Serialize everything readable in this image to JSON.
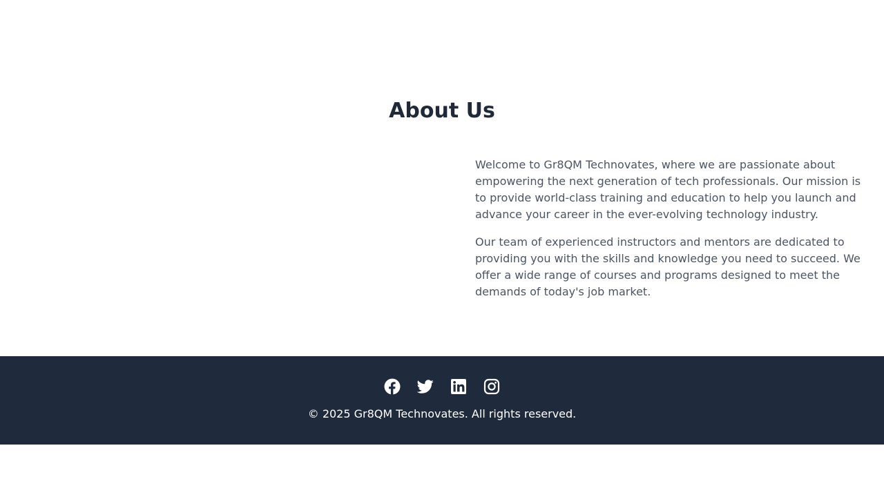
{
  "about": {
    "title": "About Us",
    "paragraphs": [
      "Welcome to Gr8QM Technovates, where we are passionate about empowering the next generation of tech professionals. Our mission is to provide world-class training and education to help you launch and advance your career in the ever-evolving technology industry.",
      "Our team of experienced instructors and mentors are dedicated to providing you with the skills and knowledge you need to succeed. We offer a wide range of courses and programs designed to meet the demands of today's job market."
    ]
  },
  "footer": {
    "social": [
      {
        "icon": "facebook-icon"
      },
      {
        "icon": "twitter-icon"
      },
      {
        "icon": "linkedin-icon"
      },
      {
        "icon": "instagram-icon"
      }
    ],
    "copyright": "© 2025 Gr8QM Technovates. All rights reserved."
  },
  "colors": {
    "heading": "#1f2937",
    "body_text": "#4b5563",
    "footer_bg": "#1f2a3c",
    "footer_text": "#ffffff"
  }
}
